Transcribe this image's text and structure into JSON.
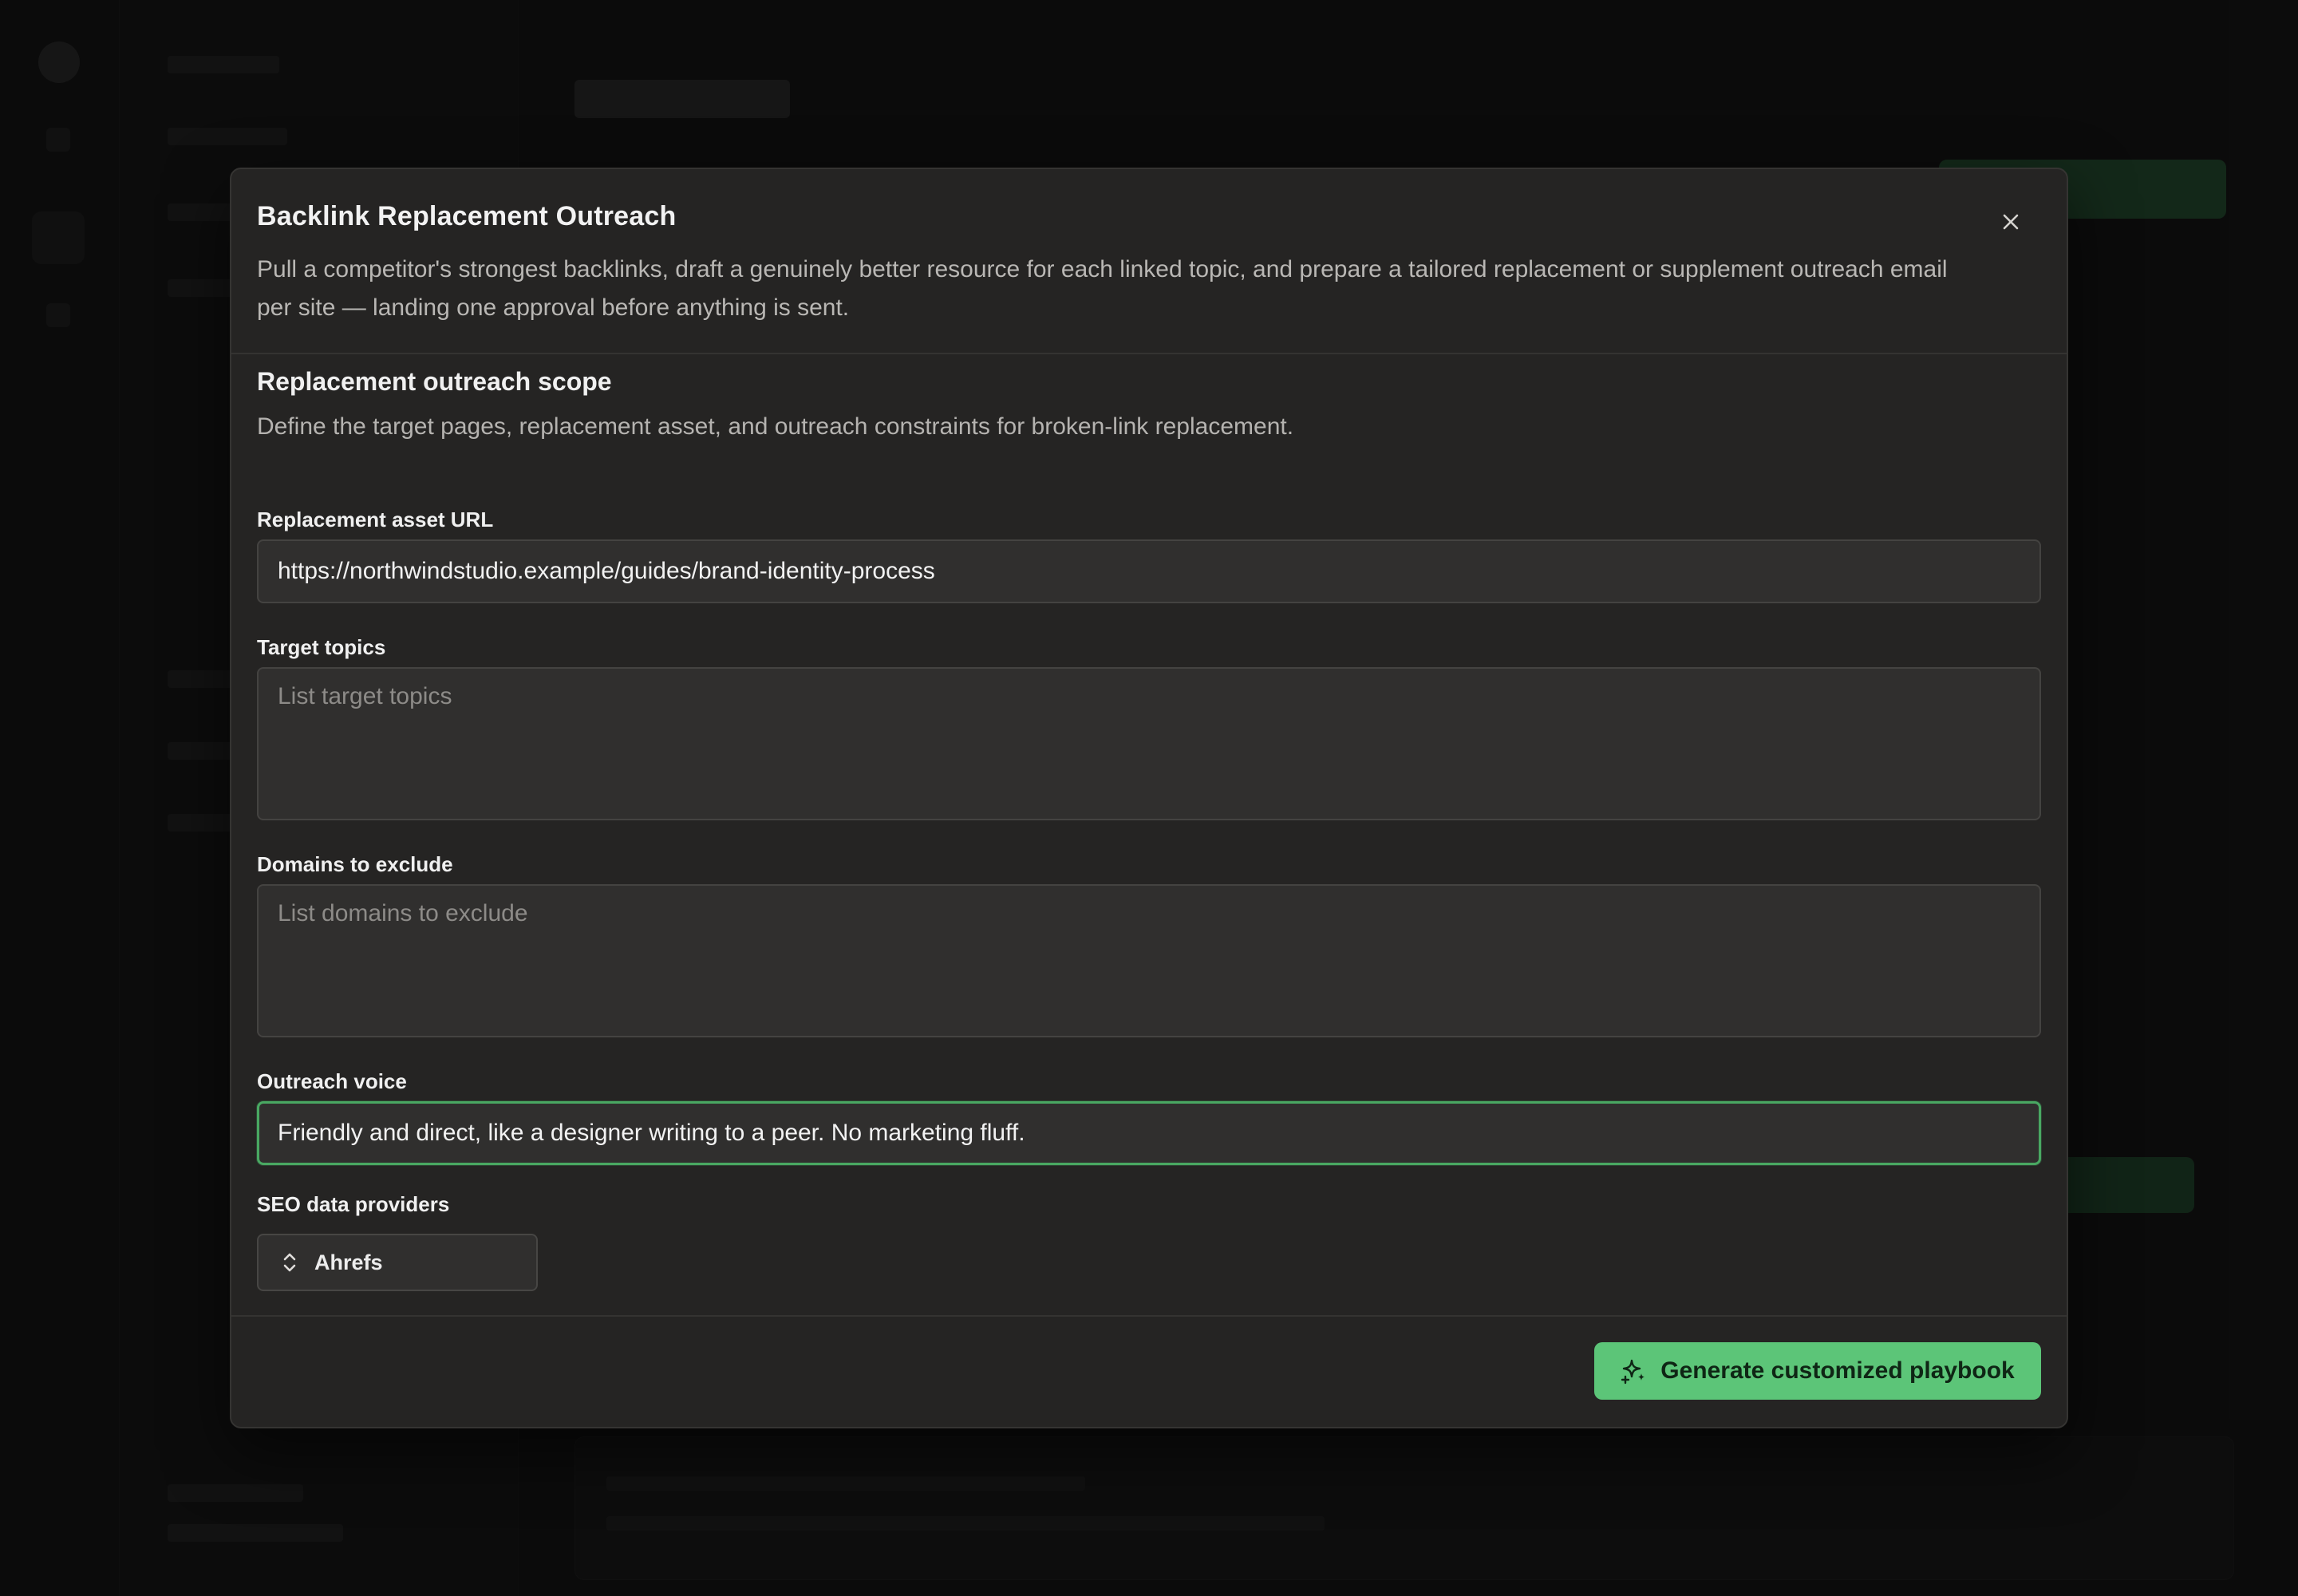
{
  "modal": {
    "title": "Backlink Replacement Outreach",
    "description": "Pull a competitor's strongest backlinks, draft a genuinely better resource for each linked topic, and prepare a tailored replacement or supplement outreach email per site — landing one approval before anything is sent.",
    "close_icon": "close-icon"
  },
  "section": {
    "title": "Replacement outreach scope",
    "description": "Define the target pages, replacement asset, and outreach constraints for broken-link replacement."
  },
  "fields": {
    "asset_url": {
      "label": "Replacement asset URL",
      "value": "https://northwindstudio.example/guides/brand-identity-process"
    },
    "target_topics": {
      "label": "Target topics",
      "placeholder": "List target topics",
      "value": ""
    },
    "exclude_domains": {
      "label": "Domains to exclude",
      "placeholder": "List domains to exclude",
      "value": ""
    },
    "outreach_voice": {
      "label": "Outreach voice",
      "value": "Friendly and direct, like a designer writing to a peer. No marketing fluff."
    },
    "seo_providers": {
      "label": "SEO data providers",
      "selected": "Ahrefs",
      "icon": "chevron-up-down-icon"
    }
  },
  "footer": {
    "generate_label": "Generate customized playbook",
    "generate_icon": "sparkle-icon"
  },
  "colors": {
    "accent": "#5cc578",
    "focus_ring": "#49a862",
    "modal_bg": "#252423"
  }
}
